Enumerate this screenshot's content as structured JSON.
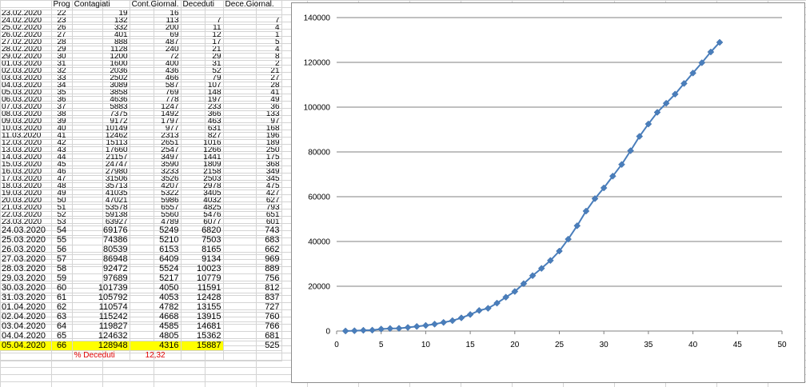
{
  "sheet": {
    "headers": [
      "",
      "Prog",
      "Contagiati",
      "Cont.Giornal.",
      "Deceduti",
      "Dece.Giornal."
    ],
    "rows": [
      [
        "23.02.2020",
        "22",
        "19",
        "16",
        "",
        ""
      ],
      [
        "24.02.2020",
        "23",
        "132",
        "113",
        "7",
        "7"
      ],
      [
        "25.02.2020",
        "26",
        "332",
        "200",
        "11",
        "4"
      ],
      [
        "26.02.2020",
        "27",
        "401",
        "69",
        "12",
        "1"
      ],
      [
        "27.02.2020",
        "28",
        "888",
        "487",
        "17",
        "5"
      ],
      [
        "28.02.2020",
        "29",
        "1128",
        "240",
        "21",
        "4"
      ],
      [
        "29.02.2020",
        "30",
        "1200",
        "72",
        "29",
        "8"
      ],
      [
        "01.03.2020",
        "31",
        "1600",
        "400",
        "31",
        "2"
      ],
      [
        "02.03.2020",
        "32",
        "2036",
        "436",
        "52",
        "21"
      ],
      [
        "03.03.2020",
        "33",
        "2502",
        "466",
        "79",
        "27"
      ],
      [
        "04.03.2020",
        "34",
        "3089",
        "587",
        "107",
        "28"
      ],
      [
        "05.03.2020",
        "35",
        "3858",
        "769",
        "148",
        "41"
      ],
      [
        "06.03.2020",
        "36",
        "4636",
        "778",
        "197",
        "49"
      ],
      [
        "07.03.2020",
        "37",
        "5883",
        "1247",
        "233",
        "36"
      ],
      [
        "08.03.2020",
        "38",
        "7375",
        "1492",
        "366",
        "133"
      ],
      [
        "09.03.2020",
        "39",
        "9172",
        "1797",
        "463",
        "97"
      ],
      [
        "10.03.2020",
        "40",
        "10149",
        "977",
        "631",
        "168"
      ],
      [
        "11.03.2020",
        "41",
        "12462",
        "2313",
        "827",
        "196"
      ],
      [
        "12.03.2020",
        "42",
        "15113",
        "2651",
        "1016",
        "189"
      ],
      [
        "13.03.2020",
        "43",
        "17660",
        "2547",
        "1266",
        "250"
      ],
      [
        "14.03.2020",
        "44",
        "21157",
        "3497",
        "1441",
        "175"
      ],
      [
        "15.03.2020",
        "45",
        "24747",
        "3590",
        "1809",
        "368"
      ],
      [
        "16.03.2020",
        "46",
        "27980",
        "3233",
        "2158",
        "349"
      ],
      [
        "17.03.2020",
        "47",
        "31506",
        "3526",
        "2503",
        "345"
      ],
      [
        "18.03.2020",
        "48",
        "35713",
        "4207",
        "2978",
        "475"
      ],
      [
        "19.03.2020",
        "49",
        "41035",
        "5322",
        "3405",
        "427"
      ],
      [
        "20.03.2020",
        "50",
        "47021",
        "5986",
        "4032",
        "627"
      ],
      [
        "21.03.2020",
        "51",
        "53578",
        "6557",
        "4825",
        "793"
      ],
      [
        "22.03.2020",
        "52",
        "59138",
        "5560",
        "5476",
        "651"
      ],
      [
        "23.03.2020",
        "53",
        "63927",
        "4789",
        "6077",
        "601"
      ],
      [
        "24.03.2020",
        "54",
        "69176",
        "5249",
        "6820",
        "743"
      ],
      [
        "25.03.2020",
        "55",
        "74386",
        "5210",
        "7503",
        "683"
      ],
      [
        "26.03.2020",
        "56",
        "80539",
        "6153",
        "8165",
        "662"
      ],
      [
        "27.03.2020",
        "57",
        "86948",
        "6409",
        "9134",
        "969"
      ],
      [
        "28.03.2020",
        "58",
        "92472",
        "5524",
        "10023",
        "889"
      ],
      [
        "29.03.2020",
        "59",
        "97689",
        "5217",
        "10779",
        "756"
      ],
      [
        "30.03.2020",
        "60",
        "101739",
        "4050",
        "11591",
        "812"
      ],
      [
        "31.03.2020",
        "61",
        "105792",
        "4053",
        "12428",
        "837"
      ],
      [
        "01.04.2020",
        "62",
        "110574",
        "4782",
        "13155",
        "727"
      ],
      [
        "02.04.2020",
        "63",
        "115242",
        "4668",
        "13915",
        "760"
      ],
      [
        "03.04.2020",
        "64",
        "119827",
        "4585",
        "14681",
        "766"
      ],
      [
        "04.04.2020",
        "65",
        "124632",
        "4805",
        "15362",
        "681"
      ],
      [
        "05.04.2020",
        "66",
        "128948",
        "4316",
        "15887",
        "525"
      ]
    ],
    "percent_label": "% Deceduti",
    "percent_value": "12,32",
    "highlight_color": "#ffff00",
    "percent_color": "#e00000"
  },
  "chart_data": {
    "type": "line",
    "title": "",
    "xlabel": "",
    "ylabel": "",
    "xlim": [
      0,
      50
    ],
    "ylim": [
      0,
      140000
    ],
    "xticks": [
      0,
      5,
      10,
      15,
      20,
      25,
      30,
      35,
      40,
      45,
      50
    ],
    "yticks": [
      0,
      20000,
      40000,
      60000,
      80000,
      100000,
      120000,
      140000
    ],
    "grid": "horizontal",
    "legend": "none",
    "line_color": "#4a7ebb",
    "marker": "diamond",
    "series": [
      {
        "x": [
          1,
          2,
          3,
          4,
          5,
          6,
          7,
          8,
          9,
          10,
          11,
          12,
          13,
          14,
          15,
          16,
          17,
          18,
          19,
          20,
          21,
          22,
          23,
          24,
          25,
          26,
          27,
          28,
          29,
          30,
          31,
          32,
          33,
          34,
          35,
          36,
          37,
          38,
          39,
          40,
          41,
          42,
          43
        ],
        "values": [
          19,
          132,
          332,
          401,
          888,
          1128,
          1200,
          1600,
          2036,
          2502,
          3089,
          3858,
          4636,
          5883,
          7375,
          9172,
          10149,
          12462,
          15113,
          17660,
          21157,
          24747,
          27980,
          31506,
          35713,
          41035,
          47021,
          53578,
          59138,
          63927,
          69176,
          74386,
          80539,
          86948,
          92472,
          97689,
          101739,
          105792,
          110574,
          115242,
          119827,
          124632,
          128948
        ]
      }
    ]
  }
}
